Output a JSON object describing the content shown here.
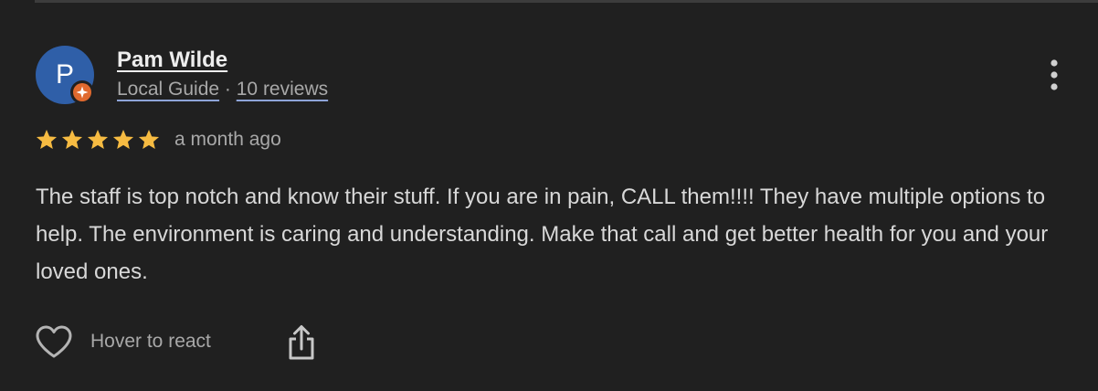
{
  "review": {
    "author": {
      "name": "Pam Wilde",
      "initial": "P",
      "badge": "Local Guide",
      "separator": " · ",
      "reviews_count": "10 reviews",
      "avatar_color": "#2f5fa8",
      "badge_color": "#e0692e"
    },
    "rating": {
      "stars": 5,
      "max": 5,
      "star_color": "#f6bb42"
    },
    "timestamp": "a month ago",
    "text": "The staff is top notch and know their stuff. If you are in pain, CALL them!!!! They have multiple options to help. The environment is caring and understanding. Make that call and get better health for you and your loved ones.",
    "actions": {
      "react_label": "Hover to react",
      "like_icon": "heart-outline-icon",
      "share_icon": "share-icon",
      "more_icon": "more-vertical-icon"
    }
  }
}
